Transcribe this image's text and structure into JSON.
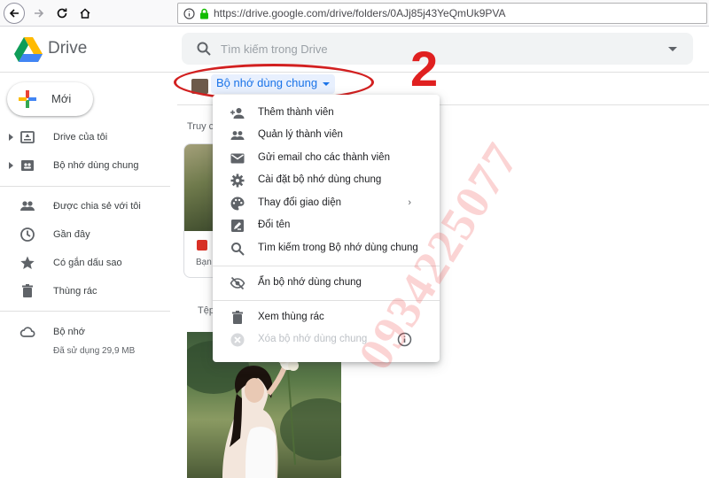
{
  "browser": {
    "url": "https://drive.google.com/drive/folders/0AJj85j43YeQmUk9PVA"
  },
  "app": {
    "name": "Drive"
  },
  "search": {
    "placeholder": "Tìm kiếm trong Drive"
  },
  "sidebar": {
    "new_label": "Mới",
    "items": [
      {
        "label": "Drive của tôi",
        "icon": "drive-icon"
      },
      {
        "label": "Bộ nhớ dùng chung",
        "icon": "shared-drive-icon"
      },
      {
        "label": "Được chia sẻ với tôi",
        "icon": "people-icon"
      },
      {
        "label": "Gần đây",
        "icon": "clock-icon"
      },
      {
        "label": "Có gắn dấu sao",
        "icon": "star-icon"
      },
      {
        "label": "Thùng rác",
        "icon": "trash-icon"
      },
      {
        "label": "Bộ nhớ",
        "icon": "cloud-icon"
      }
    ],
    "storage_used": "Đã sử dụng 29,9 MB"
  },
  "breadcrumb": {
    "title": "Bộ nhớ dùng chung"
  },
  "main": {
    "quick_access_label": "Truy c",
    "files_label": "Tệp",
    "quick_card_name": "Bạn"
  },
  "context_menu": {
    "items": [
      {
        "label": "Thêm thành viên",
        "icon": "person-add-icon"
      },
      {
        "label": "Quản lý thành viên",
        "icon": "people-icon"
      },
      {
        "label": "Gửi email cho các thành viên",
        "icon": "mail-icon"
      },
      {
        "label": "Cài đặt bộ nhớ dùng chung",
        "icon": "gear-icon"
      },
      {
        "label": "Thay đổi giao diện",
        "icon": "palette-icon",
        "submenu_arrow": "›"
      },
      {
        "label": "Đổi tên",
        "icon": "rename-icon"
      },
      {
        "label": "Tìm kiếm trong Bộ nhớ dùng chung",
        "icon": "search-icon"
      },
      {
        "label": "Ẩn bộ nhớ dùng chung",
        "icon": "eye-off-icon"
      },
      {
        "label": "Xem thùng rác",
        "icon": "trash-icon"
      },
      {
        "label": "Xóa bộ nhớ dùng chung",
        "icon": "cancel-icon",
        "disabled": true
      }
    ]
  },
  "annotations": {
    "step_number": "2",
    "watermark": "0934225077"
  },
  "colors": {
    "accent_blue": "#1a73e8",
    "annotation_red": "#d22020"
  }
}
